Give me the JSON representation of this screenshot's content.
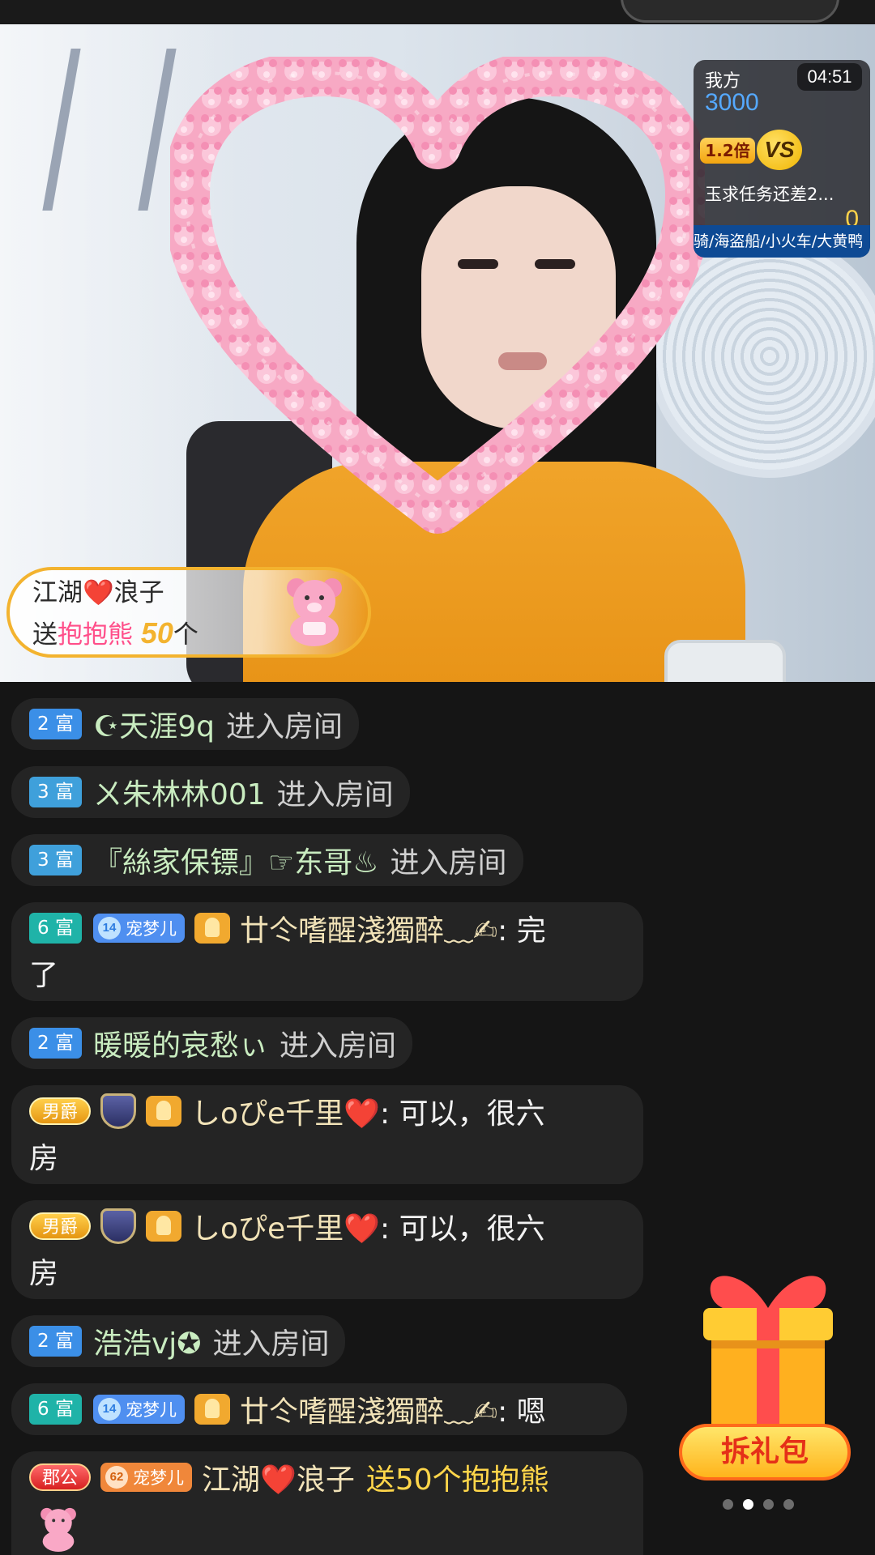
{
  "pk": {
    "our_label": "我方",
    "our_score": "3000",
    "timer": "04:51",
    "multiplier": "1.2倍",
    "vs": "VS",
    "task": "玉求任务还差2...",
    "their_score": "0",
    "ticker": "骑/海盗船/小火车/大黄鸭"
  },
  "gift_banner": {
    "sender": "江湖❤️浪子",
    "send": "送",
    "gift": "抱抱熊",
    "count": "50",
    "unit": "个"
  },
  "chat": [
    {
      "level": "2 富",
      "name": "☪天涯9q",
      "action": "进入房间"
    },
    {
      "level": "3 富",
      "name": "ㄨ朱林林001",
      "action": "进入房间"
    },
    {
      "level": "3 富",
      "name": "『絲家保镖』☞东哥♨",
      "action": "进入房间"
    },
    {
      "level": "6 富",
      "fan_badge": "宠梦儿",
      "fan_level": "14",
      "name": "廿仒嗜醒淺獨醉﹏✍",
      "text": ": 完",
      "cont": "了"
    },
    {
      "level": "2 富",
      "name": "暖暖的哀愁ぃ",
      "action": "进入房间"
    },
    {
      "noble": "男爵",
      "name": "しoぴe千里❤️",
      "text": ": 可以，很六",
      "cont": "房"
    },
    {
      "noble": "男爵",
      "name": "しoぴe千里❤️",
      "text": ": 可以，很六",
      "cont": "房"
    },
    {
      "level": "2 富",
      "name": "浩浩vj✪",
      "action": "进入房间"
    },
    {
      "level": "6 富",
      "fan_badge": "宠梦儿",
      "fan_level": "14",
      "name": "廿仒嗜醒淺獨醉﹏✍",
      "text": ": 嗯"
    },
    {
      "noble": "郡公",
      "fan_badge": "宠梦儿",
      "fan_level": "62",
      "name": "江湖❤️浪子",
      "gift": "送50个抱抱熊"
    }
  ],
  "giftbox": {
    "label": "拆礼包"
  },
  "pager": {
    "total": 4,
    "active": 2
  },
  "colors": {
    "accent_gold": "#f3b32f",
    "pink": "#ff4f8a",
    "chat_bg": "#242424"
  }
}
